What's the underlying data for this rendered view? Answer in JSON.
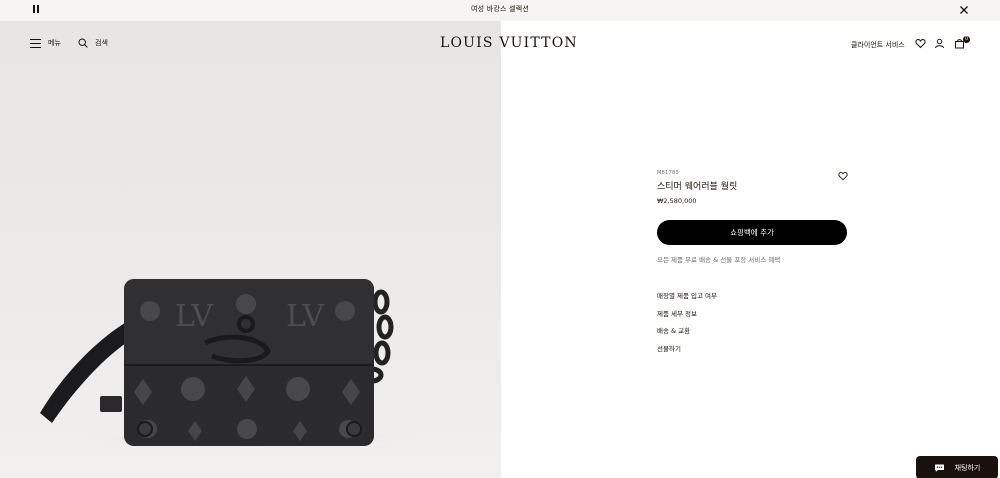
{
  "announcement": {
    "text": "여성 바캉스 셀렉션",
    "pause_icon": "pause-icon",
    "close_icon": "close-icon"
  },
  "header": {
    "menu_label": "메뉴",
    "search_label": "검색",
    "logo": "LOUIS VUITTON",
    "client_services_label": "클라이언트 서비스",
    "icons": [
      "menu-icon",
      "search-icon",
      "wishlist-icon",
      "account-icon",
      "shopping-bag-icon"
    ],
    "cart_count": "0"
  },
  "product": {
    "sku": "M81783",
    "name": "스티머 웨어러블 월릿",
    "price": "₩2,580,000",
    "wishlist_icon": "heart-icon",
    "add_to_cart_label": "쇼핑백에 추가",
    "service_note": "모든 제품 무료 배송 & 선물 포장 서비스 혜택",
    "links": [
      "매장별 제품 입고 여부",
      "제품 세부 정보",
      "배송 & 교환",
      "선물하기"
    ]
  },
  "chat": {
    "label": "채팅하기",
    "icon": "chat-bubble-icon"
  },
  "colors": {
    "brand_dark": "#19110b",
    "background": "#ffffff",
    "announcement_bg": "#f6f5f3",
    "button_bg": "#000000"
  }
}
